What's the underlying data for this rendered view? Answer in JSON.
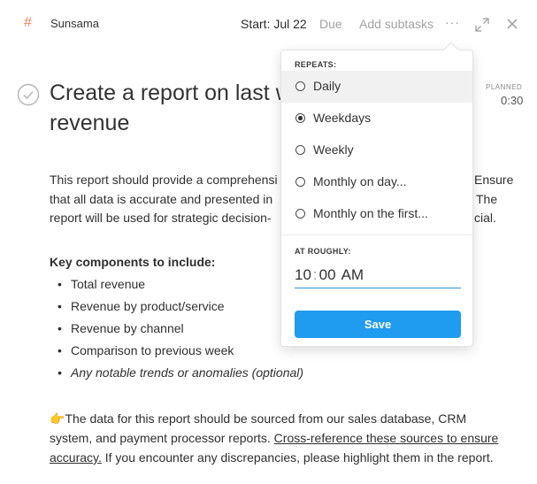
{
  "header": {
    "channel_icon": "#",
    "channel_name": "Sunsama",
    "start_label": "Start: Jul 22",
    "due_label": "Due",
    "add_subtasks_label": "Add subtasks",
    "more_label": "···"
  },
  "task": {
    "title_line1": "Create a report on last w",
    "title_line2": "revenue",
    "planned_label": "PLANNED",
    "planned_value": "0:30"
  },
  "description": {
    "line1": "This report should provide a comprehensi",
    "line1_end": "Ensure",
    "line2": "that all data is accurate and presented in",
    "line2_end": "The",
    "line3": "report will be used for strategic decision-",
    "line3_end": "cial.",
    "key_components_heading": "Key components to include:",
    "bullets": [
      "Total revenue",
      "Revenue by product/service",
      "Revenue by channel",
      "Comparison to previous week",
      "Any notable trends or anomalies (optional)"
    ],
    "footer_emoji": "👉",
    "footer_part1": "The data for this report should be sourced from our sales database, CRM system, and payment processor reports. ",
    "footer_link": "Cross-reference these sources to ensure accuracy.",
    "footer_part2": " If you encounter any discrepancies, please highlight them in the report."
  },
  "popup": {
    "repeats_label": "REPEATS:",
    "options": [
      {
        "label": "Daily",
        "selected": false
      },
      {
        "label": "Weekdays",
        "selected": true
      },
      {
        "label": "Weekly",
        "selected": false
      },
      {
        "label": "Monthly on day...",
        "selected": false
      },
      {
        "label": "Monthly on the first...",
        "selected": false
      }
    ],
    "at_roughly_label": "AT ROUGHLY:",
    "time_hour": "10",
    "time_minute": "00",
    "time_ampm": "AM",
    "save_label": "Save"
  },
  "colors": {
    "accent": "#1f9bf0",
    "channel_hash": "#f28a5f",
    "muted": "#a3a3a3"
  }
}
